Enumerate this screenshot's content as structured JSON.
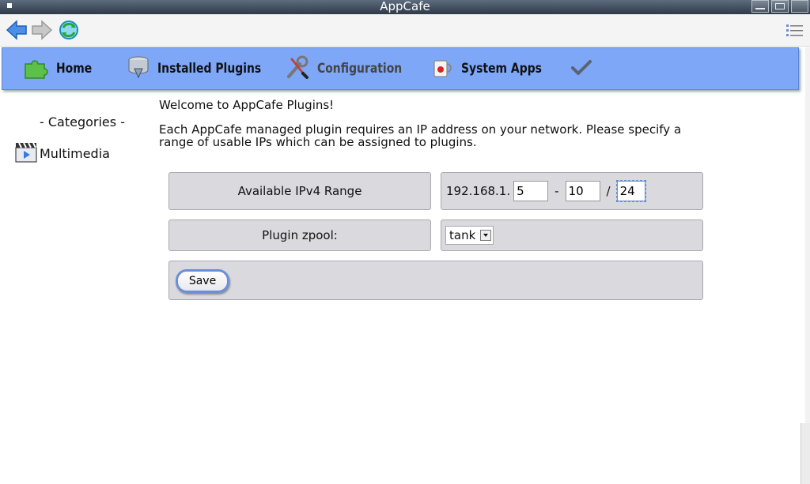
{
  "window": {
    "title": "AppCafe"
  },
  "tabs": [
    {
      "label": "Home",
      "icon": "puzzle-icon"
    },
    {
      "label": "Installed Plugins",
      "icon": "database-download-icon"
    },
    {
      "label": "Configuration",
      "icon": "wrench-screwdriver-icon",
      "active": true
    },
    {
      "label": "System Apps",
      "icon": "mug-icon"
    },
    {
      "label": "",
      "icon": "checkmark-icon"
    }
  ],
  "sidebar": {
    "title": "- Categories -",
    "items": [
      {
        "label": "Multimedia",
        "icon": "clapperboard-icon"
      }
    ]
  },
  "main": {
    "welcome": "Welcome to AppCafe Plugins!",
    "description": "Each AppCafe managed plugin requires an IP address on your network. Please specify a range of usable IPs which can be assigned to plugins.",
    "ipv4": {
      "label": "Available IPv4 Range",
      "prefix": "192.168.1.",
      "start": "5",
      "dash": "-",
      "end": "10",
      "slash": "/",
      "netmask": "24"
    },
    "zpool": {
      "label": "Plugin zpool:",
      "selected": "tank"
    },
    "save_label": "Save"
  },
  "colors": {
    "tabbar": "#7fa7f7",
    "panel": "#d9d9de",
    "accent": "#6b8fd6"
  }
}
